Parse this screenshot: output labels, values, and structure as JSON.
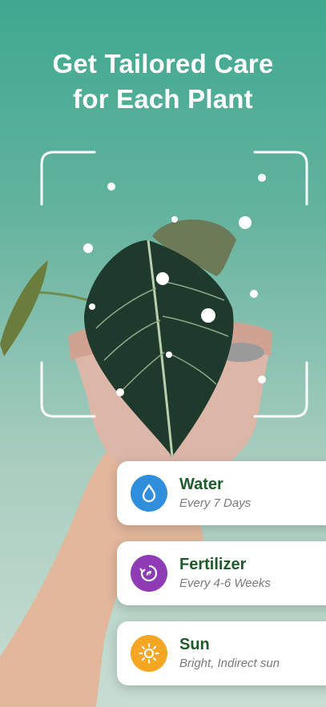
{
  "headline": {
    "line1": "Get Tailored Care",
    "line2": "for Each Plant"
  },
  "colors": {
    "water": "#2f8fdc",
    "fertilizer": "#8e3bb5",
    "sun": "#f5a623",
    "title_green": "#1f5a2b"
  },
  "cards": [
    {
      "icon": "water-drop-icon",
      "title": "Water",
      "subtitle": "Every 7 Days"
    },
    {
      "icon": "fertilizer-icon",
      "title": "Fertilizer",
      "subtitle": "Every 4-6 Weeks"
    },
    {
      "icon": "sun-icon",
      "title": "Sun",
      "subtitle": "Bright, Indirect sun"
    }
  ]
}
